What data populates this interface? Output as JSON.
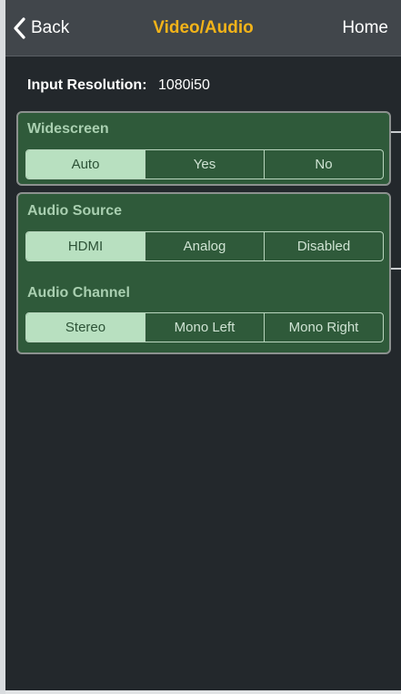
{
  "nav": {
    "back_label": "Back",
    "title": "Video/Audio",
    "home_label": "Home"
  },
  "input_resolution": {
    "label": "Input Resolution:",
    "value": "1080i50"
  },
  "widescreen": {
    "title": "Widescreen",
    "options": [
      "Auto",
      "Yes",
      "No"
    ],
    "selected": "Auto"
  },
  "audio_source": {
    "title": "Audio Source",
    "options": [
      "HDMI",
      "Analog",
      "Disabled"
    ],
    "selected": "HDMI"
  },
  "audio_channel": {
    "title": "Audio Channel",
    "options": [
      "Stereo",
      "Mono Left",
      "Mono Right"
    ],
    "selected": "Stereo"
  },
  "colors": {
    "title_accent": "#f2b319",
    "panel_bg": "#2f5a3a",
    "selected_bg": "#b8e0c0"
  }
}
